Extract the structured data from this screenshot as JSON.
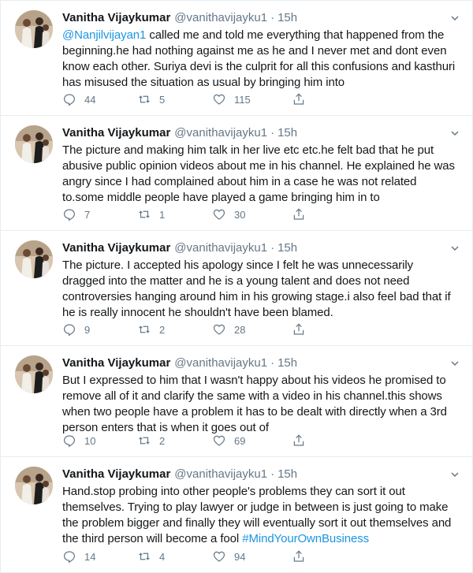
{
  "author": {
    "name": "Vanitha Vijaykumar",
    "handle": "@vanithavijayku1",
    "separator": "·"
  },
  "colors": {
    "link": "#1b95e0",
    "secondary": "#657786",
    "divider": "#e6ecf0"
  },
  "icons": [
    "reply-icon",
    "retweet-icon",
    "like-icon",
    "share-icon",
    "chevron-down-icon"
  ],
  "tweets": [
    {
      "time": "15h",
      "mention": "@Nanjilvijayan1",
      "text": " called me and told me everything that happened from the beginning.he had nothing against me as he and I never met and dont even know each other. Suriya devi is the culprit for all this confusions and kasthuri has misused the situation as usual by bringing him into",
      "replies": "44",
      "retweets": "5",
      "likes": "115"
    },
    {
      "time": "15h",
      "text": "The picture and making him talk in her live etc etc.he felt bad that he put abusive public opinion videos about me in his channel. He explained he was angry since I had complained about him in a case he was not related to.some middle people have played a game bringing him in to",
      "replies": "7",
      "retweets": "1",
      "likes": "30"
    },
    {
      "time": "15h",
      "text": "The picture. I accepted his apology since I felt he was unnecessarily dragged into the matter and he is a young talent and does not need controversies hanging around him in his growing stage.i also feel bad that if he is really innocent he shouldn't have been blamed.",
      "replies": "9",
      "retweets": "2",
      "likes": "28"
    },
    {
      "time": "15h",
      "text": "But I expressed to him that I wasn't happy about his videos he promised to remove all of it and clarify the same with a video in his channel.this shows when two people have a problem it has to be dealt with directly when a 3rd person enters that is when it goes out of",
      "replies": "10",
      "retweets": "2",
      "likes": "69"
    },
    {
      "time": "15h",
      "text": "Hand.stop probing into other people's problems they can sort it out themselves. Trying to play lawyer or judge in between is just going to make the problem bigger and finally they will eventually sort it out themselves and the third person will become a fool ",
      "hashtag": "#MindYourOwnBusiness",
      "replies": "14",
      "retweets": "4",
      "likes": "94"
    }
  ]
}
